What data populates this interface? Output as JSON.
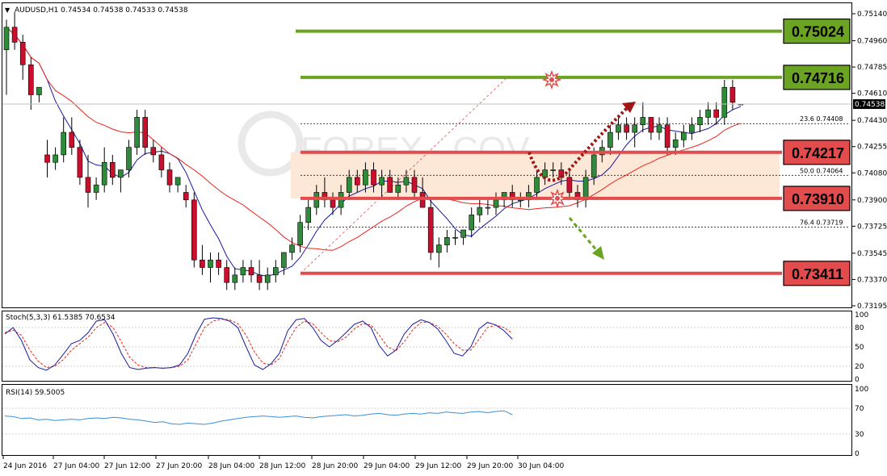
{
  "chart_data": {
    "type": "candlestick",
    "symbol_header": "AUDUSD,H1  0.74534 0.74538 0.74533 0.74538",
    "current_price": "0.74538",
    "y_ticks": [
      "0.75140",
      "0.74960",
      "0.74785",
      "0.74610",
      "0.74430",
      "0.74255",
      "0.74080",
      "0.73900",
      "0.73725",
      "0.73545",
      "0.73370",
      "0.73195"
    ],
    "y_range": [
      0.73195,
      0.7514
    ],
    "x_ticks": [
      "24 Jun 2016",
      "27 Jun 04:00",
      "27 Jun 12:00",
      "27 Jun 20:00",
      "28 Jun 04:00",
      "28 Jun 12:00",
      "28 Jun 20:00",
      "29 Jun 04:00",
      "29 Jun 12:00",
      "29 Jun 20:00",
      "30 Jun 04:00"
    ],
    "candles": [
      [
        0.749,
        0.751,
        0.746,
        0.7505
      ],
      [
        0.7505,
        0.7515,
        0.749,
        0.7495
      ],
      [
        0.7495,
        0.75,
        0.747,
        0.748
      ],
      [
        0.748,
        0.7485,
        0.745,
        0.746
      ],
      [
        0.746,
        0.7465,
        0.7455,
        0.7465
      ],
      [
        0.742,
        0.743,
        0.7405,
        0.7415
      ],
      [
        0.7415,
        0.7425,
        0.741,
        0.742
      ],
      [
        0.742,
        0.7445,
        0.7415,
        0.7435
      ],
      [
        0.7435,
        0.7445,
        0.742,
        0.7425
      ],
      [
        0.7425,
        0.743,
        0.74,
        0.7405
      ],
      [
        0.7405,
        0.742,
        0.7385,
        0.7395
      ],
      [
        0.7395,
        0.7405,
        0.739,
        0.74
      ],
      [
        0.74,
        0.7425,
        0.7395,
        0.7415
      ],
      [
        0.7415,
        0.742,
        0.74,
        0.7405
      ],
      [
        0.7405,
        0.741,
        0.7395,
        0.741
      ],
      [
        0.741,
        0.743,
        0.7405,
        0.7425
      ],
      [
        0.7425,
        0.745,
        0.742,
        0.7445
      ],
      [
        0.7445,
        0.745,
        0.742,
        0.7425
      ],
      [
        0.7425,
        0.743,
        0.7415,
        0.742
      ],
      [
        0.742,
        0.7425,
        0.7405,
        0.741
      ],
      [
        0.741,
        0.7415,
        0.7395,
        0.74
      ],
      [
        0.74,
        0.7405,
        0.7395,
        0.7405
      ],
      [
        0.7395,
        0.74,
        0.7385,
        0.739
      ],
      [
        0.739,
        0.7395,
        0.7345,
        0.735
      ],
      [
        0.735,
        0.736,
        0.734,
        0.7345
      ],
      [
        0.7345,
        0.7355,
        0.7335,
        0.735
      ],
      [
        0.735,
        0.7355,
        0.734,
        0.7345
      ],
      [
        0.7345,
        0.735,
        0.733,
        0.7335
      ],
      [
        0.7335,
        0.7345,
        0.733,
        0.734
      ],
      [
        0.734,
        0.735,
        0.7335,
        0.7345
      ],
      [
        0.7345,
        0.735,
        0.7335,
        0.734
      ],
      [
        0.734,
        0.735,
        0.733,
        0.7335
      ],
      [
        0.7335,
        0.7345,
        0.733,
        0.734
      ],
      [
        0.734,
        0.735,
        0.7335,
        0.7345
      ],
      [
        0.7345,
        0.7355,
        0.734,
        0.7355
      ],
      [
        0.7355,
        0.7365,
        0.735,
        0.736
      ],
      [
        0.736,
        0.738,
        0.7355,
        0.7375
      ],
      [
        0.7375,
        0.739,
        0.737,
        0.7385
      ],
      [
        0.7385,
        0.74,
        0.738,
        0.7395
      ],
      [
        0.7395,
        0.7405,
        0.7385,
        0.739
      ],
      [
        0.739,
        0.7395,
        0.738,
        0.7385
      ],
      [
        0.7385,
        0.74,
        0.738,
        0.7395
      ],
      [
        0.7395,
        0.741,
        0.739,
        0.7405
      ],
      [
        0.7405,
        0.741,
        0.7395,
        0.74
      ],
      [
        0.74,
        0.7415,
        0.7395,
        0.741
      ],
      [
        0.741,
        0.7415,
        0.7395,
        0.74
      ],
      [
        0.74,
        0.741,
        0.739,
        0.7405
      ],
      [
        0.7405,
        0.741,
        0.7395,
        0.7395
      ],
      [
        0.7395,
        0.7405,
        0.739,
        0.74
      ],
      [
        0.74,
        0.741,
        0.7395,
        0.7405
      ],
      [
        0.7405,
        0.741,
        0.739,
        0.7395
      ],
      [
        0.7395,
        0.7405,
        0.7385,
        0.7385
      ],
      [
        0.7385,
        0.739,
        0.735,
        0.7355
      ],
      [
        0.7355,
        0.7365,
        0.7345,
        0.736
      ],
      [
        0.736,
        0.737,
        0.7355,
        0.7365
      ],
      [
        0.7365,
        0.737,
        0.736,
        0.7365
      ],
      [
        0.7365,
        0.737,
        0.736,
        0.737
      ],
      [
        0.737,
        0.7385,
        0.7365,
        0.738
      ],
      [
        0.738,
        0.739,
        0.7375,
        0.7385
      ],
      [
        0.7385,
        0.739,
        0.738,
        0.7385
      ],
      [
        0.7385,
        0.7395,
        0.738,
        0.739
      ],
      [
        0.739,
        0.7395,
        0.7385,
        0.7395
      ],
      [
        0.7395,
        0.74,
        0.7385,
        0.739
      ],
      [
        0.739,
        0.7395,
        0.7385,
        0.739
      ],
      [
        0.739,
        0.74,
        0.7385,
        0.7395
      ],
      [
        0.7395,
        0.741,
        0.739,
        0.7405
      ],
      [
        0.7405,
        0.7415,
        0.74,
        0.741
      ],
      [
        0.741,
        0.7415,
        0.7405,
        0.741
      ],
      [
        0.741,
        0.7415,
        0.74,
        0.7405
      ],
      [
        0.7405,
        0.741,
        0.739,
        0.7395
      ],
      [
        0.7395,
        0.74,
        0.7385,
        0.739
      ],
      [
        0.739,
        0.741,
        0.7385,
        0.7405
      ],
      [
        0.7405,
        0.7425,
        0.74,
        0.742
      ],
      [
        0.742,
        0.743,
        0.7415,
        0.7425
      ],
      [
        0.7425,
        0.744,
        0.742,
        0.7435
      ],
      [
        0.7435,
        0.7445,
        0.743,
        0.744
      ],
      [
        0.744,
        0.7445,
        0.743,
        0.7435
      ],
      [
        0.7435,
        0.7445,
        0.7425,
        0.744
      ],
      [
        0.744,
        0.7455,
        0.7435,
        0.7445
      ],
      [
        0.7445,
        0.7445,
        0.743,
        0.7435
      ],
      [
        0.7435,
        0.7445,
        0.743,
        0.744
      ],
      [
        0.744,
        0.7445,
        0.742,
        0.7425
      ],
      [
        0.7425,
        0.7435,
        0.742,
        0.743
      ],
      [
        0.743,
        0.744,
        0.7425,
        0.7435
      ],
      [
        0.7435,
        0.7445,
        0.743,
        0.744
      ],
      [
        0.744,
        0.745,
        0.7435,
        0.7445
      ],
      [
        0.7445,
        0.7455,
        0.744,
        0.745
      ],
      [
        0.745,
        0.7455,
        0.744,
        0.7445
      ],
      [
        0.7445,
        0.747,
        0.744,
        0.7465
      ],
      [
        0.7465,
        0.747,
        0.745,
        0.7455
      ],
      [
        0.74534,
        0.74538,
        0.74533,
        0.74538
      ]
    ],
    "levels": [
      {
        "label": "0.75024",
        "value": 0.75024,
        "color": "#6aa422"
      },
      {
        "label": "0.74716",
        "value": 0.74716,
        "color": "#6aa422"
      },
      {
        "label": "0.74217",
        "value": 0.74217,
        "color": "#e24c4c"
      },
      {
        "label": "0.73910",
        "value": 0.7391,
        "color": "#e24c4c"
      },
      {
        "label": "0.73411",
        "value": 0.73411,
        "color": "#e24c4c"
      }
    ],
    "fib_levels": [
      {
        "label": "23.6  0.74408",
        "value": 0.74408
      },
      {
        "label": "50.0  0.74064",
        "value": 0.74064
      },
      {
        "label": "76.4  0.73719",
        "value": 0.73719
      }
    ],
    "colors": {
      "bull": "#2e8b3a",
      "bear": "#c8102e",
      "ma_fast": "#1a1aa0",
      "ma_slow": "#e8261a",
      "zone": "#fde7d6",
      "stoch_main": "#1a1aa0",
      "stoch_signal": "#e8261a",
      "rsi": "#3b8fd6"
    },
    "stoch": {
      "label": "Stoch(5,3,3) 61.5385 70.6534",
      "ticks": [
        "100",
        "80",
        "50",
        "20",
        "0"
      ],
      "main": [
        70,
        80,
        60,
        30,
        18,
        14,
        22,
        38,
        55,
        60,
        72,
        90,
        92,
        70,
        40,
        18,
        15,
        17,
        18,
        17,
        18,
        22,
        40,
        70,
        93,
        95,
        94,
        90,
        80,
        50,
        22,
        15,
        24,
        40,
        75,
        92,
        94,
        80,
        60,
        50,
        60,
        72,
        85,
        90,
        80,
        52,
        36,
        45,
        70,
        85,
        92,
        88,
        78,
        60,
        40,
        36,
        50,
        78,
        88,
        84,
        75,
        62
      ],
      "signal": [
        72,
        76,
        68,
        45,
        28,
        18,
        20,
        30,
        45,
        55,
        65,
        80,
        88,
        80,
        58,
        34,
        22,
        18,
        18,
        17,
        18,
        20,
        30,
        55,
        80,
        90,
        93,
        92,
        86,
        68,
        42,
        25,
        22,
        32,
        58,
        80,
        90,
        86,
        72,
        60,
        58,
        65,
        78,
        86,
        84,
        68,
        50,
        44,
        58,
        76,
        88,
        88,
        82,
        70,
        55,
        45,
        45,
        62,
        80,
        84,
        80,
        71
      ]
    },
    "rsi": {
      "label": "RSI(14) 59.5005",
      "ticks": [
        "100",
        "70",
        "30",
        "0"
      ],
      "values": [
        58,
        57,
        54,
        55,
        52,
        53,
        51,
        52,
        53,
        52,
        54,
        55,
        54,
        56,
        55,
        53,
        52,
        50,
        48,
        49,
        46,
        45,
        47,
        46,
        45,
        47,
        50,
        52,
        54,
        56,
        57,
        58,
        57,
        56,
        57,
        58,
        56,
        55,
        57,
        58,
        59,
        60,
        58,
        59,
        61,
        62,
        60,
        59,
        61,
        62,
        61,
        63,
        62,
        64,
        63,
        62,
        64,
        65,
        63,
        65,
        66,
        60
      ]
    },
    "arrows": [
      "bearish-dotted",
      "bullish-dotted"
    ]
  },
  "watermark": "FOREX...COV"
}
